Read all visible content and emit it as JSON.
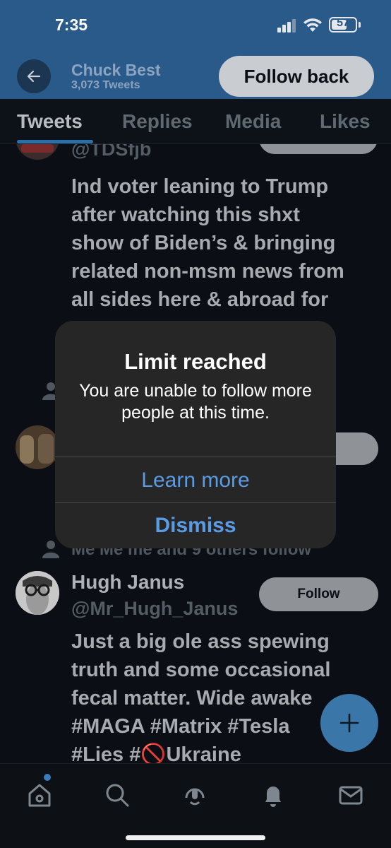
{
  "status_bar": {
    "time": "7:35",
    "battery": "57"
  },
  "header": {
    "name": "Chuck Best",
    "tweet_count": "3,073 Tweets",
    "follow_back_label": "Follow back"
  },
  "tabs": [
    {
      "label": "Tweets",
      "active": true
    },
    {
      "label": "Replies",
      "active": false
    },
    {
      "label": "Media",
      "active": false
    },
    {
      "label": "Likes",
      "active": false
    }
  ],
  "feed": {
    "first_user": {
      "handle": "@TDSfjb",
      "bio_lines": [
        "Ind voter leaning to Trump",
        "after watching this shxt",
        "show of Biden’s & bringing",
        "related non-msm news from",
        "all sides here & abroad for"
      ]
    },
    "second_follows_line": "Me Me me and 9 others follow",
    "third_user": {
      "name": "Hugh Janus",
      "handle": "@Mr_Hugh_Janus",
      "follow_label": "Follow",
      "bio_lines": [
        "Just a big ole ass spewing",
        "truth and some occasional",
        "fecal matter. Wide awake",
        "#MAGA #Matrix #Tesla",
        "#Lies #🚫Ukraine"
      ]
    }
  },
  "alert": {
    "title": "Limit reached",
    "message": "You are unable to follow more people at this time.",
    "learn_more_label": "Learn more",
    "dismiss_label": "Dismiss"
  },
  "colors": {
    "banner": "#2a5a8a",
    "alert_bg": "#262626",
    "alert_action": "#5a9be6",
    "tab_underline": "#2a6fa8"
  }
}
